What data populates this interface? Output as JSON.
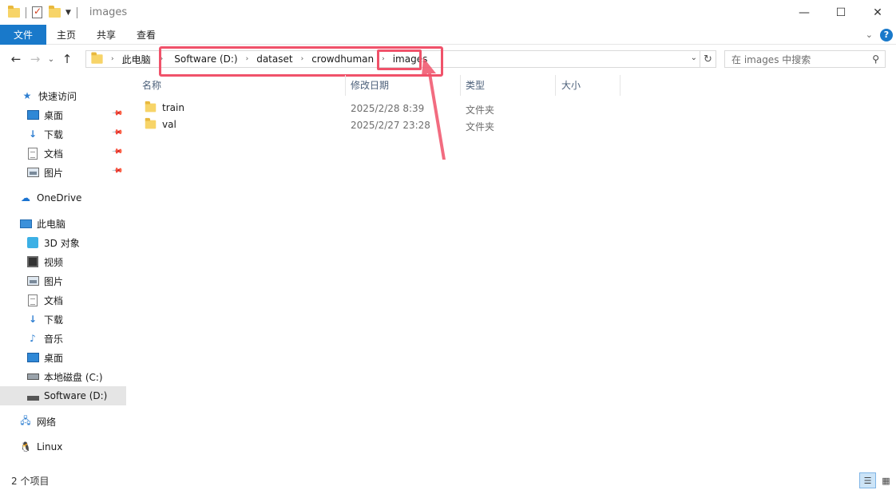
{
  "window": {
    "title": "images",
    "controls": {
      "minimize": "—",
      "maximize": "☐",
      "close": "✕"
    }
  },
  "ribbon": {
    "file": "文件",
    "tabs": [
      "主页",
      "共享",
      "查看"
    ]
  },
  "address": {
    "crumbs": [
      "此电脑",
      "Software (D:)",
      "dataset",
      "crowdhuman",
      "images"
    ],
    "search_placeholder": "在 images 中搜索"
  },
  "sidebar": {
    "quick_access": "快速访问",
    "quick_items": [
      "桌面",
      "下载",
      "文档",
      "图片"
    ],
    "onedrive": "OneDrive",
    "this_pc": "此电脑",
    "pc_items": [
      "3D 对象",
      "视频",
      "图片",
      "文档",
      "下载",
      "音乐",
      "桌面",
      "本地磁盘 (C:)",
      "Software (D:)"
    ],
    "network": "网络",
    "linux": "Linux"
  },
  "columns": {
    "name": "名称",
    "modified": "修改日期",
    "type": "类型",
    "size": "大小"
  },
  "files": [
    {
      "name": "train",
      "modified": "2025/2/28 8:39",
      "type": "文件夹",
      "size": ""
    },
    {
      "name": "val",
      "modified": "2025/2/27 23:28",
      "type": "文件夹",
      "size": ""
    }
  ],
  "status": {
    "count": "2 个项目"
  },
  "colors": {
    "accent": "#1979ca",
    "highlight": "#f0526a",
    "selected": "#e5e5e5"
  }
}
